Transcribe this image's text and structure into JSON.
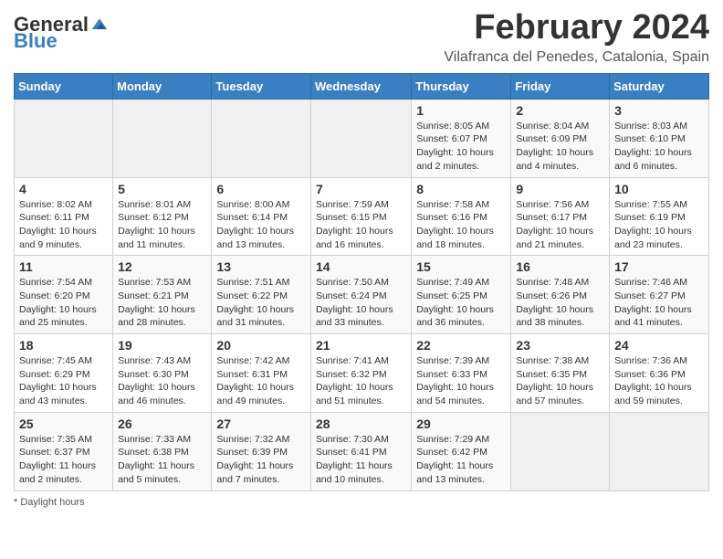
{
  "header": {
    "logo_general": "General",
    "logo_blue": "Blue",
    "main_title": "February 2024",
    "subtitle": "Vilafranca del Penedes, Catalonia, Spain"
  },
  "weekdays": [
    "Sunday",
    "Monday",
    "Tuesday",
    "Wednesday",
    "Thursday",
    "Friday",
    "Saturday"
  ],
  "weeks": [
    [
      {
        "day": "",
        "info": ""
      },
      {
        "day": "",
        "info": ""
      },
      {
        "day": "",
        "info": ""
      },
      {
        "day": "",
        "info": ""
      },
      {
        "day": "1",
        "info": "Sunrise: 8:05 AM\nSunset: 6:07 PM\nDaylight: 10 hours\nand 2 minutes."
      },
      {
        "day": "2",
        "info": "Sunrise: 8:04 AM\nSunset: 6:09 PM\nDaylight: 10 hours\nand 4 minutes."
      },
      {
        "day": "3",
        "info": "Sunrise: 8:03 AM\nSunset: 6:10 PM\nDaylight: 10 hours\nand 6 minutes."
      }
    ],
    [
      {
        "day": "4",
        "info": "Sunrise: 8:02 AM\nSunset: 6:11 PM\nDaylight: 10 hours\nand 9 minutes."
      },
      {
        "day": "5",
        "info": "Sunrise: 8:01 AM\nSunset: 6:12 PM\nDaylight: 10 hours\nand 11 minutes."
      },
      {
        "day": "6",
        "info": "Sunrise: 8:00 AM\nSunset: 6:14 PM\nDaylight: 10 hours\nand 13 minutes."
      },
      {
        "day": "7",
        "info": "Sunrise: 7:59 AM\nSunset: 6:15 PM\nDaylight: 10 hours\nand 16 minutes."
      },
      {
        "day": "8",
        "info": "Sunrise: 7:58 AM\nSunset: 6:16 PM\nDaylight: 10 hours\nand 18 minutes."
      },
      {
        "day": "9",
        "info": "Sunrise: 7:56 AM\nSunset: 6:17 PM\nDaylight: 10 hours\nand 21 minutes."
      },
      {
        "day": "10",
        "info": "Sunrise: 7:55 AM\nSunset: 6:19 PM\nDaylight: 10 hours\nand 23 minutes."
      }
    ],
    [
      {
        "day": "11",
        "info": "Sunrise: 7:54 AM\nSunset: 6:20 PM\nDaylight: 10 hours\nand 25 minutes."
      },
      {
        "day": "12",
        "info": "Sunrise: 7:53 AM\nSunset: 6:21 PM\nDaylight: 10 hours\nand 28 minutes."
      },
      {
        "day": "13",
        "info": "Sunrise: 7:51 AM\nSunset: 6:22 PM\nDaylight: 10 hours\nand 31 minutes."
      },
      {
        "day": "14",
        "info": "Sunrise: 7:50 AM\nSunset: 6:24 PM\nDaylight: 10 hours\nand 33 minutes."
      },
      {
        "day": "15",
        "info": "Sunrise: 7:49 AM\nSunset: 6:25 PM\nDaylight: 10 hours\nand 36 minutes."
      },
      {
        "day": "16",
        "info": "Sunrise: 7:48 AM\nSunset: 6:26 PM\nDaylight: 10 hours\nand 38 minutes."
      },
      {
        "day": "17",
        "info": "Sunrise: 7:46 AM\nSunset: 6:27 PM\nDaylight: 10 hours\nand 41 minutes."
      }
    ],
    [
      {
        "day": "18",
        "info": "Sunrise: 7:45 AM\nSunset: 6:29 PM\nDaylight: 10 hours\nand 43 minutes."
      },
      {
        "day": "19",
        "info": "Sunrise: 7:43 AM\nSunset: 6:30 PM\nDaylight: 10 hours\nand 46 minutes."
      },
      {
        "day": "20",
        "info": "Sunrise: 7:42 AM\nSunset: 6:31 PM\nDaylight: 10 hours\nand 49 minutes."
      },
      {
        "day": "21",
        "info": "Sunrise: 7:41 AM\nSunset: 6:32 PM\nDaylight: 10 hours\nand 51 minutes."
      },
      {
        "day": "22",
        "info": "Sunrise: 7:39 AM\nSunset: 6:33 PM\nDaylight: 10 hours\nand 54 minutes."
      },
      {
        "day": "23",
        "info": "Sunrise: 7:38 AM\nSunset: 6:35 PM\nDaylight: 10 hours\nand 57 minutes."
      },
      {
        "day": "24",
        "info": "Sunrise: 7:36 AM\nSunset: 6:36 PM\nDaylight: 10 hours\nand 59 minutes."
      }
    ],
    [
      {
        "day": "25",
        "info": "Sunrise: 7:35 AM\nSunset: 6:37 PM\nDaylight: 11 hours\nand 2 minutes."
      },
      {
        "day": "26",
        "info": "Sunrise: 7:33 AM\nSunset: 6:38 PM\nDaylight: 11 hours\nand 5 minutes."
      },
      {
        "day": "27",
        "info": "Sunrise: 7:32 AM\nSunset: 6:39 PM\nDaylight: 11 hours\nand 7 minutes."
      },
      {
        "day": "28",
        "info": "Sunrise: 7:30 AM\nSunset: 6:41 PM\nDaylight: 11 hours\nand 10 minutes."
      },
      {
        "day": "29",
        "info": "Sunrise: 7:29 AM\nSunset: 6:42 PM\nDaylight: 11 hours\nand 13 minutes."
      },
      {
        "day": "",
        "info": ""
      },
      {
        "day": "",
        "info": ""
      }
    ]
  ],
  "footer": {
    "note": "Daylight hours"
  }
}
